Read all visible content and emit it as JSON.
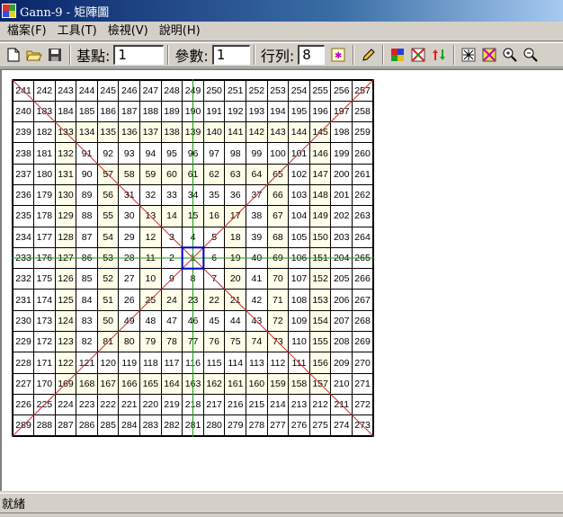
{
  "window": {
    "title": "Gann-9 - 矩陣圖"
  },
  "menu": [
    "檔案(F)",
    "工具(T)",
    "檢視(V)",
    "說明(H)"
  ],
  "toolbar": {
    "base_label": "基點:",
    "base_value": "1",
    "param_label": "參數:",
    "param_value": "1",
    "rows_label": "行列:",
    "rows_value": "8"
  },
  "grid": {
    "size": 17,
    "center": "1",
    "rows": [
      [
        "241",
        "242",
        "243",
        "244",
        "245",
        "246",
        "247",
        "248",
        "249",
        "250",
        "251",
        "252",
        "253",
        "254",
        "255",
        "256",
        "257"
      ],
      [
        "240",
        "183",
        "184",
        "185",
        "186",
        "187",
        "188",
        "189",
        "190",
        "191",
        "192",
        "193",
        "194",
        "195",
        "196",
        "197",
        "258"
      ],
      [
        "239",
        "182",
        "133",
        "134",
        "135",
        "136",
        "137",
        "138",
        "139",
        "140",
        "141",
        "142",
        "143",
        "144",
        "145",
        "198",
        "259"
      ],
      [
        "238",
        "181",
        "132",
        "91",
        "92",
        "93",
        "94",
        "95",
        "96",
        "97",
        "98",
        "99",
        "100",
        "101",
        "146",
        "199",
        "260"
      ],
      [
        "237",
        "180",
        "131",
        "90",
        "57",
        "58",
        "59",
        "60",
        "61",
        "62",
        "63",
        "64",
        "65",
        "102",
        "147",
        "200",
        "261"
      ],
      [
        "236",
        "179",
        "130",
        "89",
        "56",
        "31",
        "32",
        "33",
        "34",
        "35",
        "36",
        "37",
        "66",
        "103",
        "148",
        "201",
        "262"
      ],
      [
        "235",
        "178",
        "129",
        "88",
        "55",
        "30",
        "13",
        "14",
        "15",
        "16",
        "17",
        "38",
        "67",
        "104",
        "149",
        "202",
        "263"
      ],
      [
        "234",
        "177",
        "128",
        "87",
        "54",
        "29",
        "12",
        "3",
        "4",
        "5",
        "18",
        "39",
        "68",
        "105",
        "150",
        "203",
        "264"
      ],
      [
        "233",
        "176",
        "127",
        "86",
        "53",
        "28",
        "11",
        "2",
        "1",
        "6",
        "19",
        "40",
        "69",
        "106",
        "151",
        "204",
        "265"
      ],
      [
        "232",
        "175",
        "126",
        "85",
        "52",
        "27",
        "10",
        "9",
        "8",
        "7",
        "20",
        "41",
        "70",
        "107",
        "152",
        "205",
        "266"
      ],
      [
        "231",
        "174",
        "125",
        "84",
        "51",
        "26",
        "25",
        "24",
        "23",
        "22",
        "21",
        "42",
        "71",
        "108",
        "153",
        "206",
        "267"
      ],
      [
        "230",
        "173",
        "124",
        "83",
        "50",
        "49",
        "48",
        "47",
        "46",
        "45",
        "44",
        "43",
        "72",
        "109",
        "154",
        "207",
        "268"
      ],
      [
        "229",
        "172",
        "123",
        "82",
        "81",
        "80",
        "79",
        "78",
        "77",
        "76",
        "75",
        "74",
        "73",
        "110",
        "155",
        "208",
        "269"
      ],
      [
        "228",
        "171",
        "122",
        "121",
        "120",
        "119",
        "118",
        "117",
        "116",
        "115",
        "114",
        "113",
        "112",
        "111",
        "156",
        "209",
        "270"
      ],
      [
        "227",
        "170",
        "169",
        "168",
        "167",
        "166",
        "165",
        "164",
        "163",
        "162",
        "161",
        "160",
        "159",
        "158",
        "157",
        "210",
        "271"
      ],
      [
        "226",
        "225",
        "224",
        "223",
        "222",
        "221",
        "220",
        "219",
        "218",
        "217",
        "216",
        "215",
        "214",
        "213",
        "212",
        "211",
        "272"
      ],
      [
        "289",
        "288",
        "287",
        "286",
        "285",
        "284",
        "283",
        "282",
        "281",
        "280",
        "279",
        "278",
        "277",
        "276",
        "275",
        "274",
        "273"
      ]
    ]
  },
  "status": {
    "text": "就緒"
  },
  "colors": {
    "shade": "#fdfde8",
    "diagonal": "#c83232",
    "axis": "#1a9a1a",
    "center_box": "#0000c0"
  }
}
